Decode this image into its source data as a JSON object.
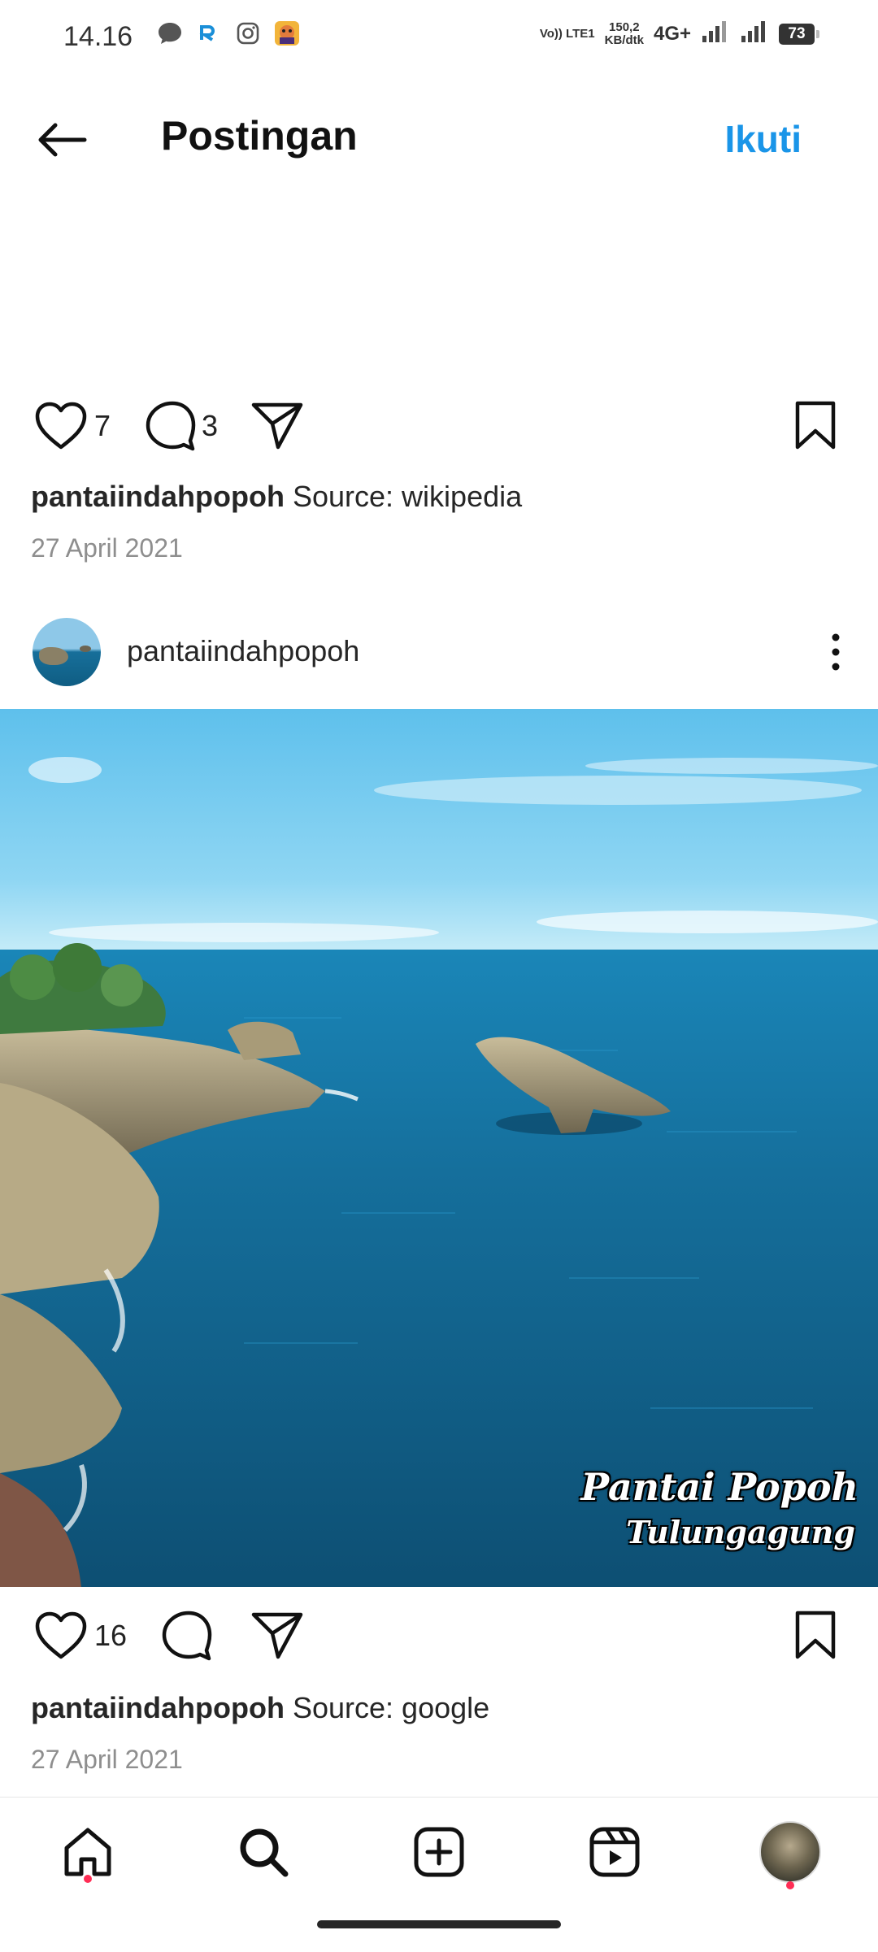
{
  "status_bar": {
    "time": "14.16",
    "volte": "Vo)) LTE1",
    "speed_value": "150,2",
    "speed_unit": "KB/dtk",
    "network": "4G+",
    "battery": "73",
    "icons": [
      "chat-bubble-icon",
      "app-r-icon",
      "instagram-icon",
      "game-avatar-icon",
      "signal-icon",
      "signal-icon"
    ]
  },
  "header": {
    "title": "Postingan",
    "follow_label": "Ikuti",
    "back_icon": "arrow-left-icon"
  },
  "posts": [
    {
      "likes": "7",
      "comments": "3",
      "username": "pantaiindahpopoh",
      "caption": "Source: wikipedia",
      "date": "27 April 2021"
    },
    {
      "username": "pantaiindahpopoh",
      "image_overlay": [
        "Pantai Popoh",
        "Tulungagung"
      ],
      "likes": "16",
      "comments": "",
      "caption": "Source: google",
      "date": "27 April 2021"
    }
  ],
  "bottom_nav": {
    "items": [
      "home-icon",
      "search-icon",
      "add-post-icon",
      "reels-icon",
      "profile-avatar"
    ]
  },
  "colors": {
    "accent": "#1a95e8",
    "text": "#262626",
    "muted": "#8e8e8e",
    "notification": "#ff2d55"
  }
}
